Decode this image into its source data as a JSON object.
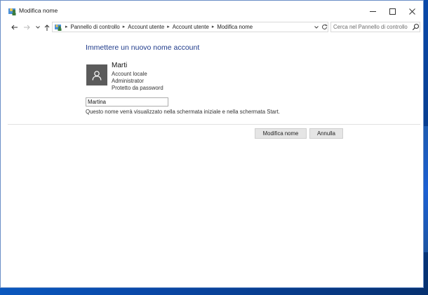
{
  "window": {
    "title": "Modifica nome",
    "controls": {
      "minimize": "minimize",
      "maximize": "maximize",
      "close": "close"
    }
  },
  "nav": {
    "back_icon": "arrow-left-icon",
    "forward_icon": "arrow-right-icon",
    "recent_icon": "chevron-down-icon",
    "up_icon": "arrow-up-icon"
  },
  "address": {
    "breadcrumbs": [
      "Pannello di controllo",
      "Account utente",
      "Account utente",
      "Modifica nome"
    ],
    "search_placeholder": "Cerca nel Pannello di controllo"
  },
  "main": {
    "heading": "Immettere un nuovo nome account",
    "user": {
      "name": "Marti",
      "lines": [
        "Account locale",
        "Administrator",
        "Protetto da password"
      ]
    },
    "name_input_value": "Martina",
    "hint": "Questo nome verrà visualizzato nella schermata iniziale e nella schermata Start.",
    "buttons": {
      "rename": "Modifica nome",
      "cancel": "Annulla"
    }
  },
  "colors": {
    "heading": "#1e3a8a",
    "avatar_bg": "#5b5b5b",
    "button_bg": "#e5e5e5",
    "desktop": "#0b5cc4"
  }
}
